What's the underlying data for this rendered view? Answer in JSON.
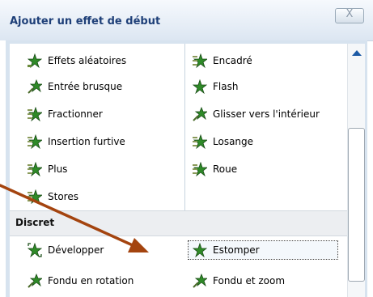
{
  "dialog": {
    "title": "Ajouter un effet de début",
    "close_label": "X"
  },
  "effects": {
    "left": [
      {
        "label": "Effets aléatoires",
        "icon": "random-star-icon"
      },
      {
        "label": "Entrée brusque",
        "icon": "fly-in-star-icon"
      },
      {
        "label": "Fractionner",
        "icon": "split-star-icon"
      },
      {
        "label": "Insertion furtive",
        "icon": "crawl-star-icon"
      },
      {
        "label": "Plus",
        "icon": "plus-star-icon"
      },
      {
        "label": "Stores",
        "icon": "blinds-star-icon"
      }
    ],
    "right": [
      {
        "label": "Encadré",
        "icon": "box-star-icon"
      },
      {
        "label": "Flash",
        "icon": "flash-star-icon"
      },
      {
        "label": "Glisser vers l'intérieur",
        "icon": "peek-star-icon"
      },
      {
        "label": "Losange",
        "icon": "diamond-star-icon"
      },
      {
        "label": "Roue",
        "icon": "wheel-star-icon"
      }
    ]
  },
  "category": {
    "label": "Discret",
    "items_left": [
      {
        "label": "Développer",
        "icon": "expand-star-icon"
      },
      {
        "label": "Fondu en rotation",
        "icon": "fade-swivel-star-icon"
      }
    ],
    "items_right": [
      {
        "label": "Estomper",
        "icon": "fade-star-icon",
        "selected": true
      },
      {
        "label": "Fondu et zoom",
        "icon": "fade-zoom-star-icon"
      }
    ]
  },
  "colors": {
    "title": "#1e3f78",
    "arrow": "#b24812",
    "icon_green": "#2f8a28",
    "scroll_arrow": "#1c5aa5"
  }
}
